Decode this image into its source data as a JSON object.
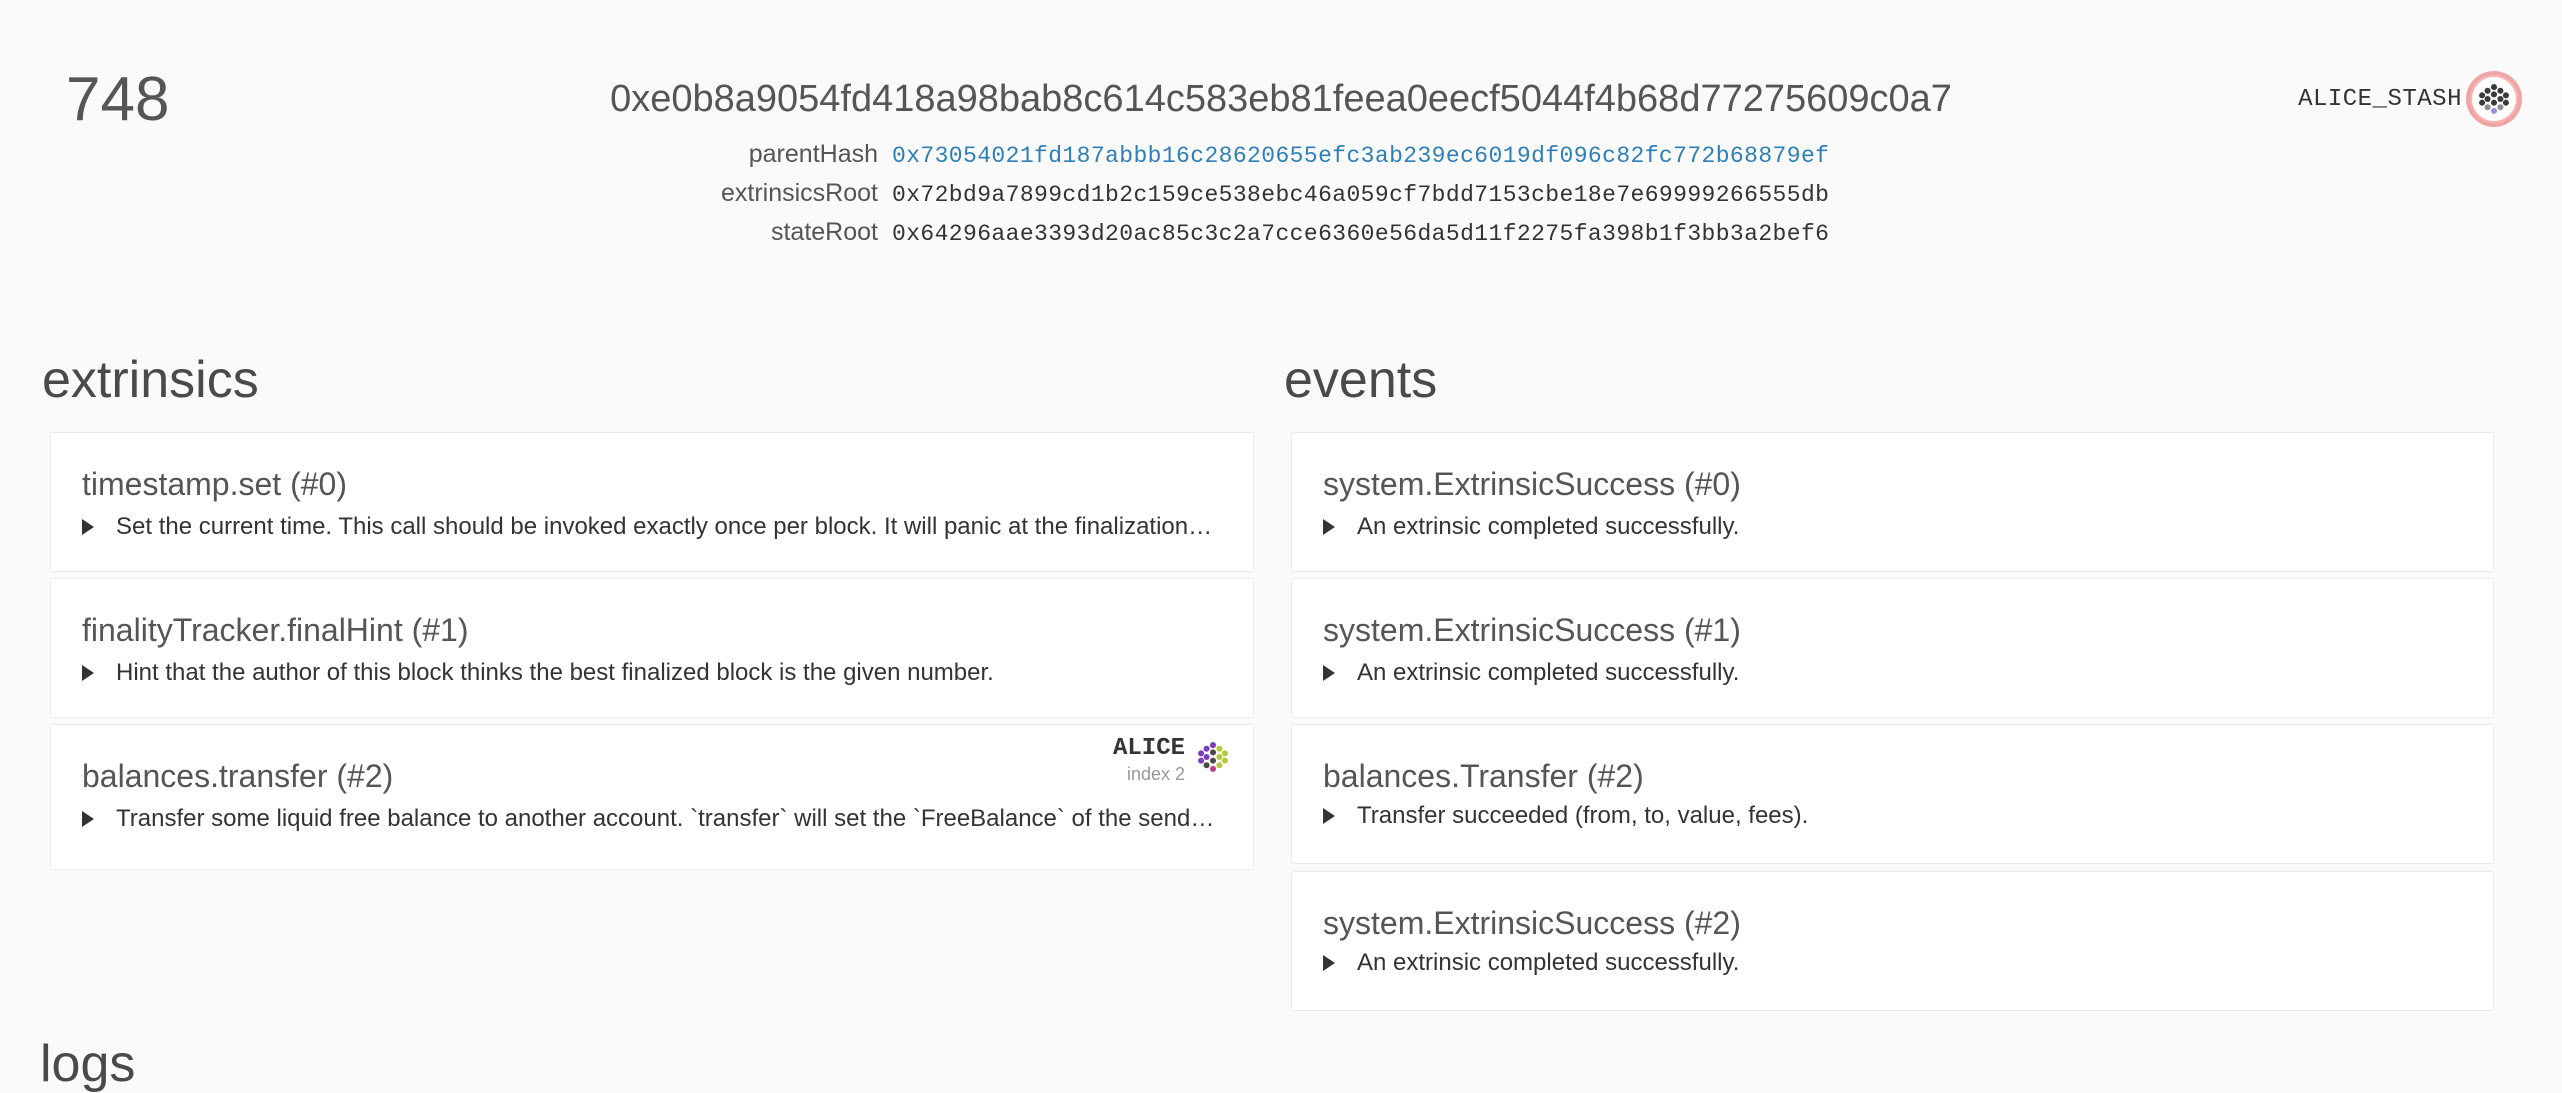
{
  "header": {
    "block_number": "748",
    "block_hash": "0xe0b8a9054fd418a98bab8c614c583eb81feea0eecf5044f4b68d77275609c0a7",
    "author": "ALICE_STASH",
    "parent_hash_label": "parentHash",
    "parent_hash": "0x73054021fd187abbb16c28620655efc3ab239ec6019df096c82fc772b68879ef",
    "extrinsics_root_label": "extrinsicsRoot",
    "extrinsics_root": "0x72bd9a7899cd1b2c159ce538ebc46a059cf7bdd7153cbe18e7e69999266555db",
    "state_root_label": "stateRoot",
    "state_root": "0x64296aae3393d20ac85c3c2a7cce6360e56da5d11f2275fa398b1f3bb3a2bef6"
  },
  "extrinsics": {
    "title": "extrinsics",
    "items": [
      {
        "title": "timestamp.set (#0)",
        "description": "Set the current time. This call should be invoked exactly once per block. It will panic at the finalization phase, if this call hasn't been invoked by that time."
      },
      {
        "title": "finalityTracker.finalHint (#1)",
        "description": "Hint that the author of this block thinks the best finalized block is the given number."
      },
      {
        "title": "balances.transfer (#2)",
        "description": "Transfer some liquid free balance to another account. `transfer` will set the `FreeBalance` of the sender and receiver.",
        "signer_name": "ALICE",
        "signer_index": "index 2"
      }
    ]
  },
  "events": {
    "title": "events",
    "items": [
      {
        "title": "system.ExtrinsicSuccess (#0)",
        "description": "An extrinsic completed successfully."
      },
      {
        "title": "system.ExtrinsicSuccess (#1)",
        "description": "An extrinsic completed successfully."
      },
      {
        "title": "balances.Transfer (#2)",
        "description": "Transfer succeeded (from, to, value, fees)."
      },
      {
        "title": "system.ExtrinsicSuccess (#2)",
        "description": "An extrinsic completed successfully."
      }
    ]
  },
  "logs": {
    "title": "logs"
  },
  "icons": {
    "author_identicon": "identicon-icon",
    "signer_identicon": "identicon-icon",
    "expand": "triangle-right-icon"
  },
  "colors": {
    "link": "#2e7fb8",
    "author_ring": "#e53e3e"
  }
}
